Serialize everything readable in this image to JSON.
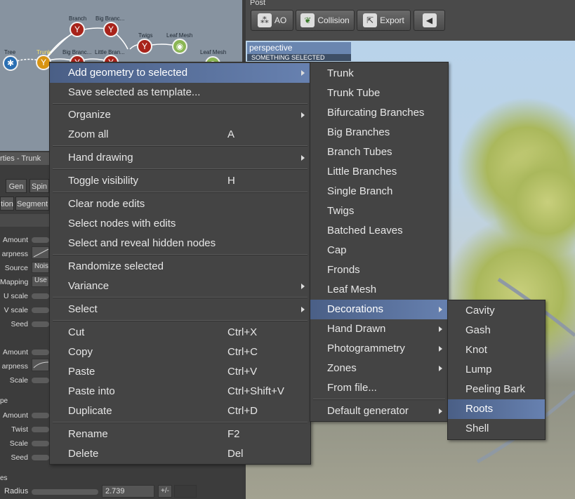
{
  "graph": {
    "nodes": [
      {
        "label": "Tree"
      },
      {
        "label": "Trunk"
      },
      {
        "label": "Branch"
      },
      {
        "label": "Big Branc..."
      },
      {
        "label": "Big Branc..."
      },
      {
        "label": "Little Bran..."
      },
      {
        "label": "Twigs"
      },
      {
        "label": "Leaf Mesh"
      },
      {
        "label": "Leaf Mesh"
      }
    ]
  },
  "props": {
    "title": "rties - Trunk",
    "tabs": [
      "Gen",
      "Spin",
      "tion",
      "Segment"
    ],
    "rows": [
      {
        "label": "Amount"
      },
      {
        "label": "arpness"
      },
      {
        "label": "Source",
        "value": "Nois"
      },
      {
        "label": "Mapping",
        "value": "Use"
      },
      {
        "label": "U scale"
      },
      {
        "label": "V scale"
      },
      {
        "label": "Seed"
      },
      {
        "label": "Amount"
      },
      {
        "label": "arpness"
      },
      {
        "label": "Scale"
      },
      {
        "label": "Amount"
      },
      {
        "label": "Twist"
      },
      {
        "label": "Scale"
      },
      {
        "label": "Seed"
      }
    ],
    "section_pe": "pe",
    "section_es": "es",
    "radius_label": "Radius",
    "radius_value": "2.739",
    "plusminus": "+/-"
  },
  "toolbar": {
    "section": "Post",
    "buttons": [
      {
        "label": "AO",
        "icon": "ao-icon"
      },
      {
        "label": "Collision",
        "icon": "leaf-icon"
      },
      {
        "label": "Export",
        "icon": "export-icon"
      },
      {
        "label": "",
        "icon": "arrow-left-icon"
      }
    ]
  },
  "viewport": {
    "label": "perspective",
    "status": "SOMETHING SELECTED"
  },
  "menu1": {
    "items": [
      {
        "label": "Add geometry to selected",
        "submenu": true,
        "highlighted": true
      },
      {
        "label": "Save selected as template..."
      },
      {
        "label": "Organize",
        "submenu": true
      },
      {
        "label": "Zoom all",
        "shortcut": "A"
      },
      {
        "label": "Hand drawing",
        "submenu": true
      },
      {
        "label": "Toggle visibility",
        "shortcut": "H"
      },
      {
        "label": "Clear node edits"
      },
      {
        "label": "Select nodes with edits"
      },
      {
        "label": "Select and reveal hidden nodes"
      },
      {
        "label": "Randomize selected"
      },
      {
        "label": "Variance",
        "submenu": true
      },
      {
        "label": "Select",
        "submenu": true
      },
      {
        "label": "Cut",
        "shortcut": "Ctrl+X"
      },
      {
        "label": "Copy",
        "shortcut": "Ctrl+C"
      },
      {
        "label": "Paste",
        "shortcut": "Ctrl+V"
      },
      {
        "label": "Paste into",
        "shortcut": "Ctrl+Shift+V"
      },
      {
        "label": "Duplicate",
        "shortcut": "Ctrl+D"
      },
      {
        "label": "Rename",
        "shortcut": "F2"
      },
      {
        "label": "Delete",
        "shortcut": "Del"
      }
    ]
  },
  "menu2": {
    "items": [
      {
        "label": "Trunk"
      },
      {
        "label": "Trunk Tube"
      },
      {
        "label": "Bifurcating Branches"
      },
      {
        "label": "Big Branches"
      },
      {
        "label": "Branch Tubes"
      },
      {
        "label": "Little Branches"
      },
      {
        "label": "Single Branch"
      },
      {
        "label": "Twigs"
      },
      {
        "label": "Batched Leaves"
      },
      {
        "label": "Cap"
      },
      {
        "label": "Fronds"
      },
      {
        "label": "Leaf Mesh"
      },
      {
        "label": "Decorations",
        "submenu": true,
        "highlighted": true
      },
      {
        "label": "Hand Drawn",
        "submenu": true
      },
      {
        "label": "Photogrammetry",
        "submenu": true
      },
      {
        "label": "Zones",
        "submenu": true
      },
      {
        "label": "From file..."
      },
      {
        "label": "Default generator",
        "submenu": true
      }
    ]
  },
  "menu3": {
    "items": [
      {
        "label": "Cavity"
      },
      {
        "label": "Gash"
      },
      {
        "label": "Knot"
      },
      {
        "label": "Lump"
      },
      {
        "label": "Peeling Bark"
      },
      {
        "label": "Roots",
        "highlighted": true
      },
      {
        "label": "Shell"
      }
    ]
  },
  "colors": {
    "menu_bg": "#444444",
    "highlight": "#5a72a0",
    "graph_bg": "#8793a0",
    "panel_bg": "#3c3c3c"
  }
}
